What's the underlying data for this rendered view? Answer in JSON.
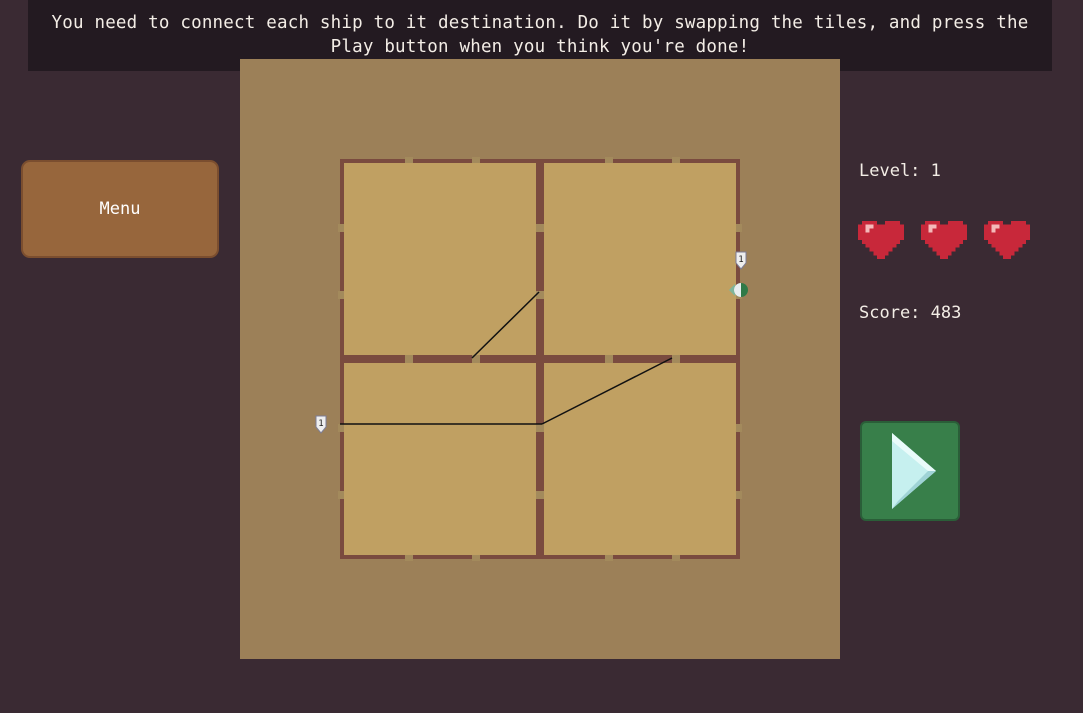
{
  "instructions": {
    "line1": "You need to connect each ship to it destination. Do it by swapping the tiles, and press the",
    "line2": "Play button when you think you're done!"
  },
  "menu": {
    "label": "Menu"
  },
  "stats": {
    "level_text": "Level: 1",
    "score_text": "Score: 483",
    "lives": 3
  },
  "ship": {
    "label": "1",
    "icon": "ship-icon"
  },
  "destination": {
    "label": "1",
    "icon": "destination-marker-icon"
  },
  "play": {
    "icon": "play-triangle-icon"
  },
  "colors": {
    "background": "#3a2a33",
    "board": "#9c8058",
    "tile": "#c0a062",
    "tile_border": "#7a4b3f",
    "menu": "#97663c",
    "play": "#387f4a",
    "heart": "#c8283a"
  }
}
